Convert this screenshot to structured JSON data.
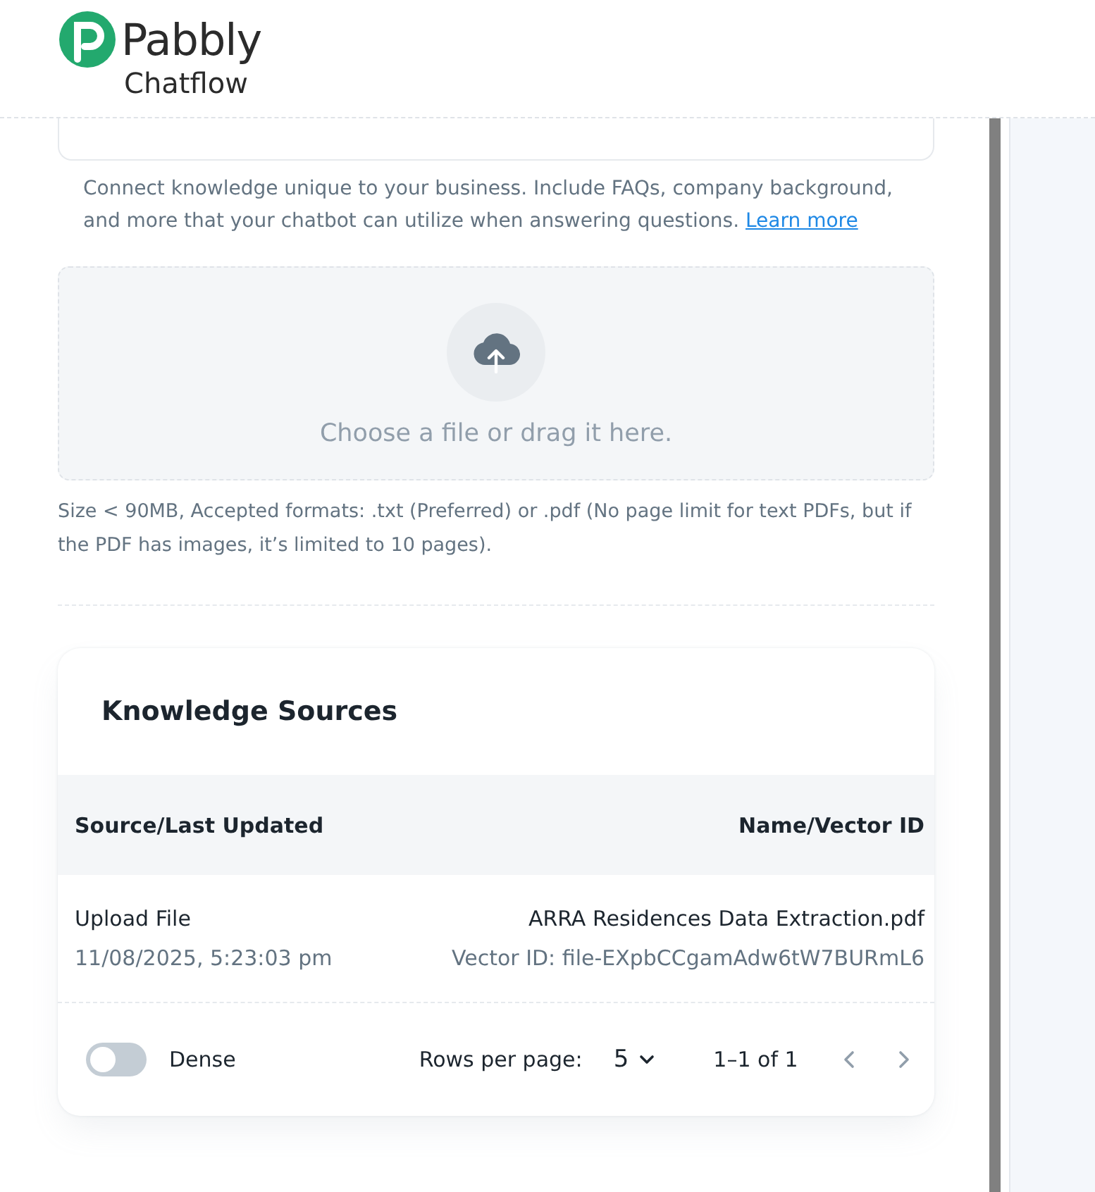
{
  "logo": {
    "line_1": "Pabbly",
    "line_2": "Chatflow"
  },
  "intro": {
    "text": "Connect knowledge unique to your business. Include FAQs, company background, and more that your chatbot can utilize when answering questions.",
    "link": "Learn more"
  },
  "dropzone": {
    "prompt": "Choose a file or drag it here."
  },
  "hint": "Size < 90MB, Accepted formats: .txt (Preferred) or .pdf (No page limit for text PDFs, but if the PDF has images, it’s limited to 10 pages).",
  "table": {
    "title": "Knowledge Sources",
    "columns": [
      "Source/Last Updated",
      "Name/Vector ID"
    ],
    "rows": [
      {
        "source": "Upload File",
        "updated": "11/08/2025, 5:23:03 pm",
        "name": "ARRA Residences Data Extraction.pdf",
        "vector_id": "Vector ID: file-EXpbCCgamAdw6tW7BURmL6"
      }
    ],
    "footer": {
      "dense_label": "Dense",
      "dense_on": false,
      "rows_per_page_label": "Rows per page:",
      "rows_per_page": "5",
      "range": "1–1 of 1"
    }
  }
}
